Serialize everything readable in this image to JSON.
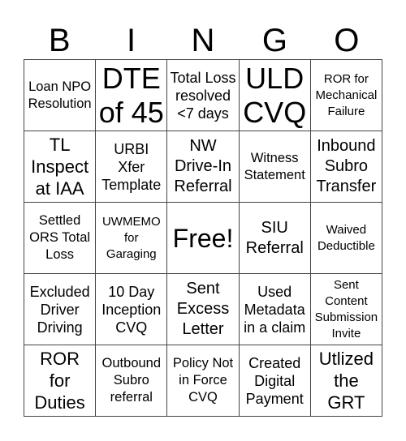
{
  "header": {
    "letters": [
      "B",
      "I",
      "N",
      "G",
      "O"
    ]
  },
  "cells": [
    "Loan NPO\nResolution",
    "DTE\nof 45",
    "Total Loss\nresolved\n<7 days",
    "ULD\nCVQ",
    "ROR for\nMechanical\nFailure",
    "TL\nInspect\nat IAA",
    "URBI\nXfer\nTemplate",
    "NW\nDrive-In\nReferral",
    "Witness\nStatement",
    "Inbound\nSubro\nTransfer",
    "Settled\nORS Total\nLoss",
    "UWMEMO\nfor\nGaraging",
    "Free!",
    "SIU\nReferral",
    "Waived\nDeductible",
    "Excluded\nDriver\nDriving",
    "10 Day\nInception\nCVQ",
    "Sent\nExcess\nLetter",
    "Used\nMetadata\nin a claim",
    "Sent\nContent\nSubmission\nInvite",
    "ROR\nfor\nDuties",
    "Outbound\nSubro\nreferral",
    "Policy Not\nin Force\nCVQ",
    "Created\nDigital\nPayment",
    "Utlized\nthe\nGRT"
  ]
}
